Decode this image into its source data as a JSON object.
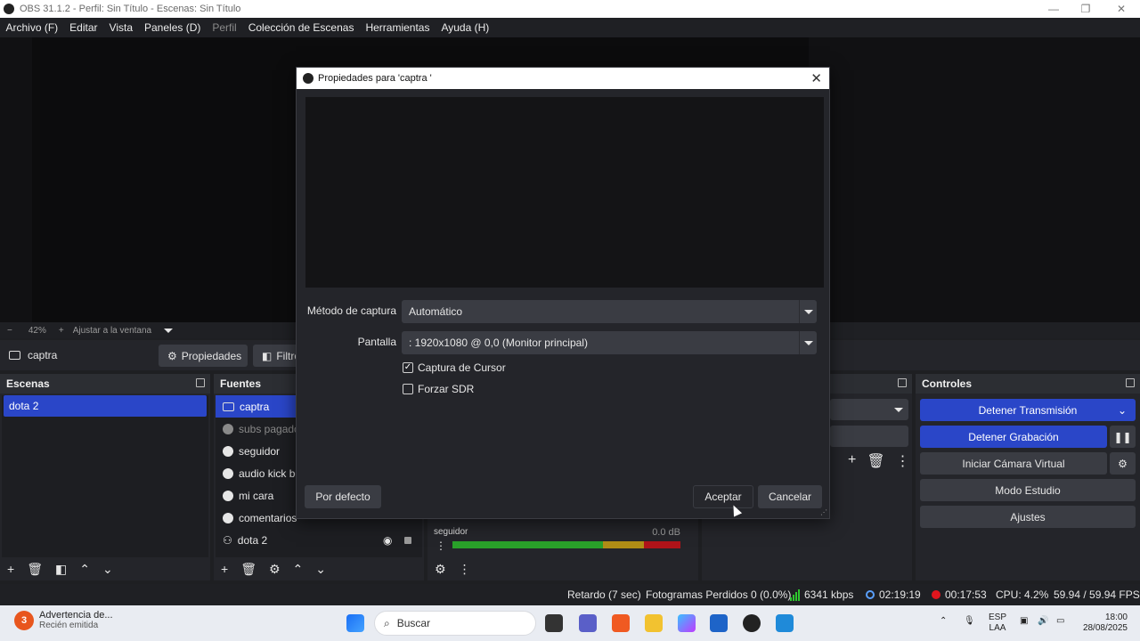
{
  "window": {
    "title": "OBS 31.1.2 - Perfil: Sin Título - Escenas: Sin Título",
    "minimize_glyph": "—",
    "maximize_glyph": "❐",
    "close_glyph": "✕"
  },
  "menu": [
    "Archivo (F)",
    "Editar",
    "Vista",
    "Paneles (D)",
    "Perfil",
    "Colección de Escenas",
    "Herramientas",
    "Ayuda (H)"
  ],
  "zoom": {
    "minus": "−",
    "value": "42%",
    "plus": "+",
    "fit_label": "Ajustar a la ventana"
  },
  "source_toolbar": {
    "source_name": "captra",
    "properties_label": "Propiedades",
    "filters_label": "Filtro"
  },
  "scenes": {
    "title": "Escenas",
    "items": [
      "dota 2"
    ]
  },
  "sources": {
    "title": "Fuentes",
    "items": [
      "captra",
      "subs pagado",
      "seguidor",
      "audio kick bo",
      "mi cara",
      "comentarios",
      "dota 2"
    ]
  },
  "mixer": {
    "channel_name": "seguidor",
    "level": "0.0 dB"
  },
  "controls": {
    "title": "Controles",
    "stop_stream": "Detener Transmisión",
    "stop_recording": "Detener Grabación",
    "virtual_cam": "Iniciar Cámara Virtual",
    "studio_mode": "Modo Estudio",
    "settings": "Ajustes"
  },
  "status": {
    "delay": "Retardo (7 sec)",
    "dropped_frames": "Fotogramas Perdidos 0 (0.0%)",
    "bitrate": "6341 kbps",
    "stream_time": "02:19:19",
    "rec_time": "00:17:53",
    "cpu": "CPU: 4.2%",
    "fps": "59.94 / 59.94 FPS"
  },
  "dialog": {
    "title": "Propiedades para 'captra '",
    "capture_method_label": "Método de captura",
    "capture_method_value": "Automático",
    "display_label": "Pantalla",
    "display_value": ": 1920x1080 @ 0,0 (Monitor principal)",
    "cursor_capture": "Captura de Cursor",
    "force_sdr": "Forzar SDR",
    "defaults_button": "Por defecto",
    "ok_button": "Aceptar",
    "cancel_button": "Cancelar",
    "cursor_checked": true,
    "sdr_checked": false
  },
  "taskbar": {
    "notice_count": "3",
    "notice_title": "Advertencia de...",
    "notice_sub": "Recién emitida",
    "search_placeholder": "Buscar",
    "lang_top": "ESP",
    "lang_bottom": "LAA",
    "time": "18:00",
    "date": "28/08/2025"
  },
  "colors": {
    "accent": "#2a46c8",
    "record": "#e0151d",
    "bitrate_ok": "#2ec62e"
  }
}
